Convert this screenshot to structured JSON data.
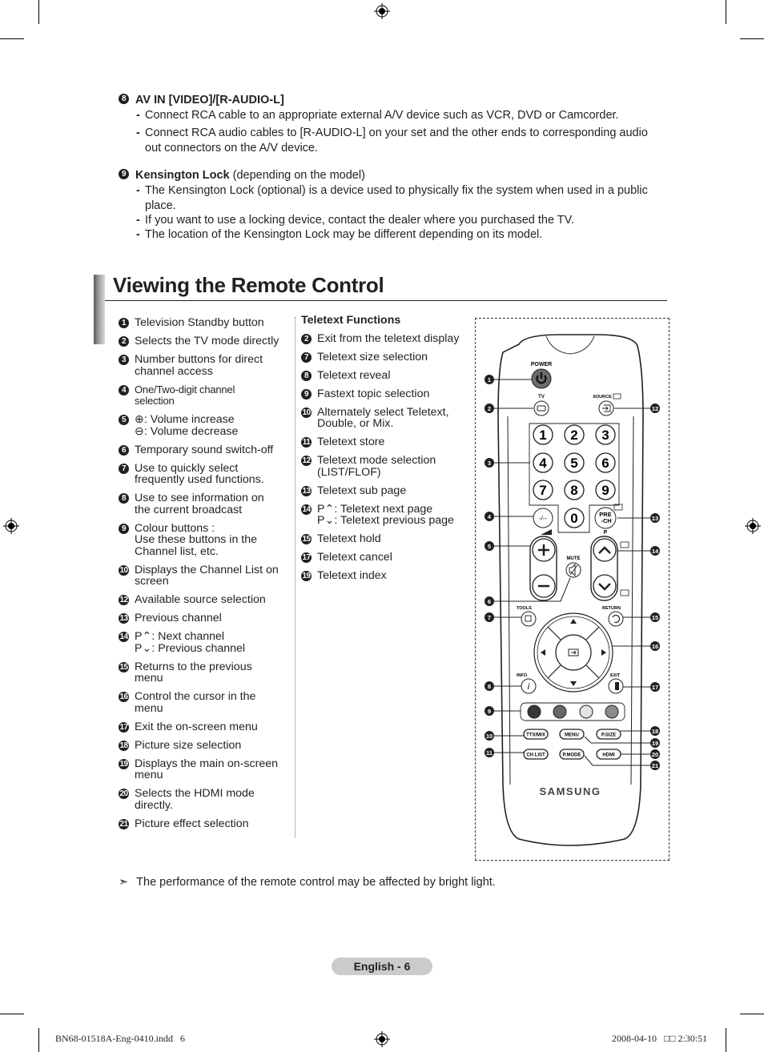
{
  "top_sections": [
    {
      "num": "8",
      "title": "AV IN [VIDEO]/[R-AUDIO-L]",
      "title_suffix": "",
      "bullets": [
        "Connect RCA cable to an appropriate external A/V device such as VCR, DVD or Camcorder.",
        "Connect RCA audio cables to [R-AUDIO-L] on your set and the other ends to corresponding audio out connectors on the A/V device."
      ]
    },
    {
      "num": "9",
      "title": "Kensington Lock",
      "title_suffix": " (depending on the model)",
      "bullets": [
        "The Kensington Lock (optional) is a device used to physically fix the system when used in a public place.",
        "If you want to use a locking device, contact the dealer where you purchased the TV.",
        "The location of the Kensington Lock may be different depending on its model."
      ]
    }
  ],
  "section_title": "Viewing the Remote Control",
  "left_list": [
    {
      "num": "1",
      "text": "Television Standby button"
    },
    {
      "num": "2",
      "text": "Selects the TV mode directly"
    },
    {
      "num": "3",
      "text": "Number buttons for direct\nchannel access"
    },
    {
      "num": "4",
      "text": "One/Two-digit channel\nselection",
      "small": true
    },
    {
      "num": "5",
      "text": "⊕: Volume increase\n⊖: Volume decrease"
    },
    {
      "num": "6",
      "text": "Temporary sound switch-off"
    },
    {
      "num": "7",
      "text": "Use to quickly select\nfrequently used functions."
    },
    {
      "num": "8",
      "text": "Use to see information on\nthe current broadcast"
    },
    {
      "num": "9",
      "text": "Colour buttons :\nUse these buttons in the\nChannel list, etc."
    },
    {
      "num": "10",
      "text": "Displays the Channel List on\nscreen"
    },
    {
      "num": "12",
      "text": "Available source selection"
    },
    {
      "num": "13",
      "text": "Previous channel"
    },
    {
      "num": "14",
      "text": "P⌃: Next channel\nP⌄: Previous channel"
    },
    {
      "num": "15",
      "text": "Returns to the previous\nmenu"
    },
    {
      "num": "16",
      "text": "Control the cursor in the\nmenu"
    },
    {
      "num": "17",
      "text": "Exit the on-screen menu"
    },
    {
      "num": "18",
      "text": "Picture size selection"
    },
    {
      "num": "19",
      "text": "Displays the main on-screen\nmenu"
    },
    {
      "num": "20",
      "text": "Selects the HDMI mode\ndirectly."
    },
    {
      "num": "21",
      "text": "Picture effect selection"
    }
  ],
  "teletext": {
    "heading": "Teletext Functions",
    "items": [
      {
        "num": "2",
        "text": "Exit from the teletext display"
      },
      {
        "num": "7",
        "text": "Teletext size selection"
      },
      {
        "num": "8",
        "text": "Teletext reveal"
      },
      {
        "num": "9",
        "text": "Fastext topic selection"
      },
      {
        "num": "10",
        "text": "Alternately select Teletext,\nDouble, or Mix."
      },
      {
        "num": "11",
        "text": "Teletext store"
      },
      {
        "num": "12",
        "text": "Teletext mode selection\n(LIST/FLOF)"
      },
      {
        "num": "13",
        "text": "Teletext sub page"
      },
      {
        "num": "14",
        "text": "P⌃: Teletext next page\nP⌄: Teletext previous page"
      },
      {
        "num": "15",
        "text": "Teletext hold"
      },
      {
        "num": "17",
        "text": "Teletext cancel"
      },
      {
        "num": "19",
        "text": "Teletext index"
      }
    ]
  },
  "remote": {
    "power": "POWER",
    "tv": "TV",
    "source": "SOURCE",
    "digits": [
      "1",
      "2",
      "3",
      "4",
      "5",
      "6",
      "7",
      "8",
      "9",
      "0"
    ],
    "dash": "-/--",
    "prech_1": "PRE",
    "prech_2": "-CH",
    "p": "P",
    "mute": "MUTE",
    "tools": "TOOLS",
    "return": "RETURN",
    "info": "INFO",
    "exit": "EXIT",
    "ttx": "TTX/MIX",
    "menu": "MENU",
    "psize": "P.SIZE",
    "chlist": "CH LIST",
    "pmode": "P.MODE",
    "hdmi": "HDMI",
    "brand": "SAMSUNG",
    "color_buttons": [
      "#3a3536",
      "#6b6767",
      "#e3e3e3",
      "#8d8b8b"
    ],
    "callouts_left": [
      "1",
      "2",
      "3",
      "4",
      "5",
      "6",
      "7",
      "8",
      "9",
      "10",
      "11"
    ],
    "callouts_right": [
      "12",
      "13",
      "14",
      "15",
      "16",
      "17",
      "18",
      "19",
      "20",
      "21"
    ]
  },
  "note": {
    "icon": "arrow-note-icon",
    "text": "The performance of the remote control may be affected by bright light."
  },
  "page_label": "English - 6",
  "footer": {
    "file": "BN68-01518A-Eng-0410.indd   6",
    "date": "2008-04-10   □□ 2:30:51"
  }
}
